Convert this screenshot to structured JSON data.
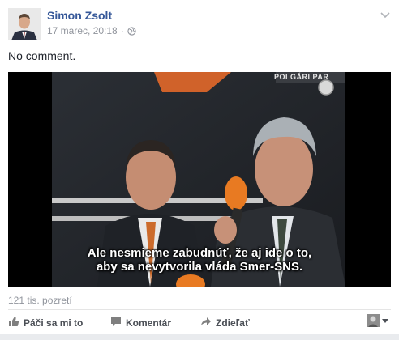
{
  "post": {
    "author": "Simon Zsolt",
    "timestamp": "17 marec, 20:18",
    "separator": "·",
    "audience_icon": "globe-icon",
    "options_icon": "chevron-down-icon",
    "message": "No comment."
  },
  "video": {
    "overlay_logo": "POLGÁRI PAR",
    "subtitle_line1": "Ale nesmieme zabudnúť, že aj ide o to,",
    "subtitle_line2": "aby sa nevytvorila vláda Smer-SNS."
  },
  "stats": {
    "views": "121 tis. pozretí"
  },
  "actions": {
    "like": "Páči sa mi to",
    "comment": "Komentár",
    "share": "Zdieľať"
  },
  "colors": {
    "author": "#365899",
    "muted": "#90949c",
    "action_text": "#4b4f56",
    "microphone": "#e87a22"
  }
}
